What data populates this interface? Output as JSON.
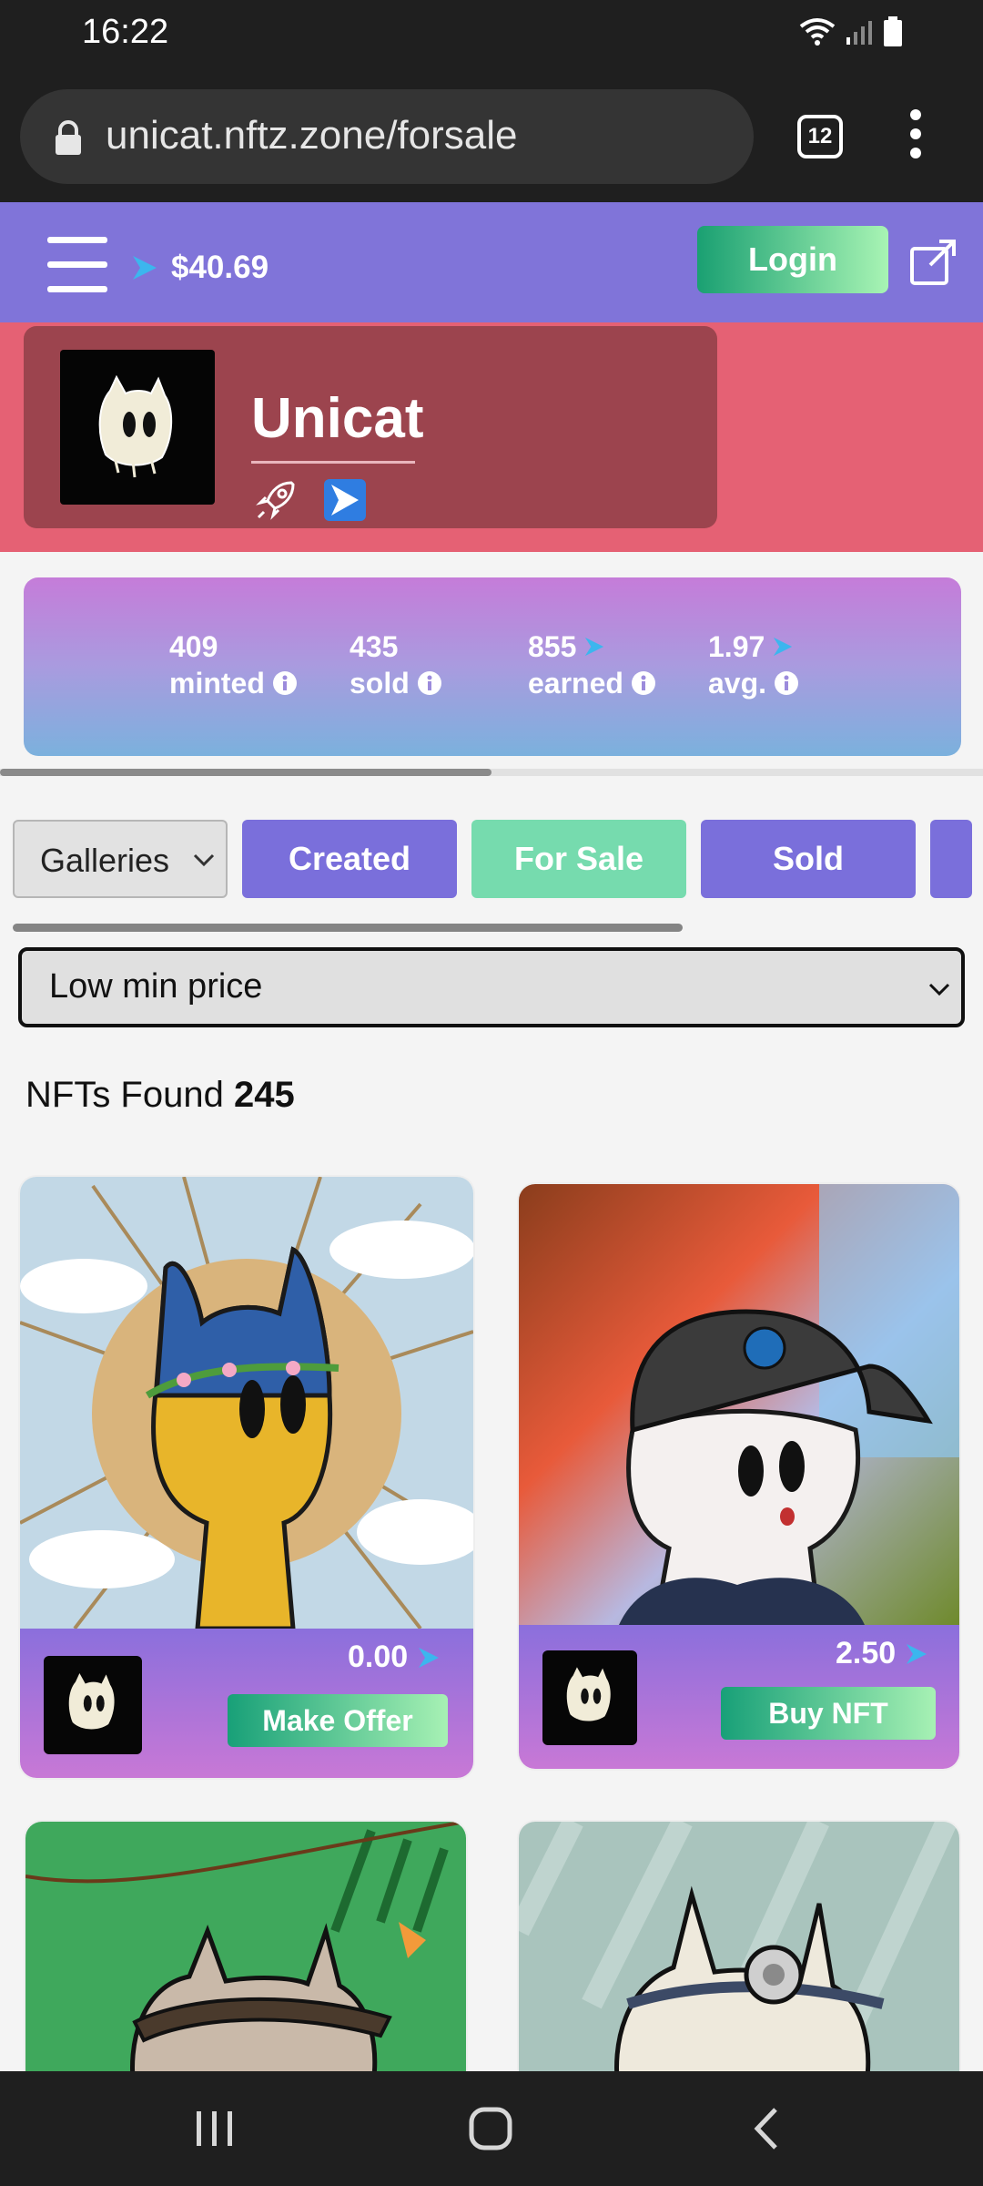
{
  "status_bar": {
    "time": "16:22"
  },
  "browser": {
    "url": "unicat.nftz.zone/forsale",
    "tab_count": "12"
  },
  "header": {
    "balance": "$40.69",
    "login_label": "Login"
  },
  "profile": {
    "name": "Unicat"
  },
  "stats": [
    {
      "value": "409",
      "label": "minted",
      "has_currency": false
    },
    {
      "value": "435",
      "label": "sold",
      "has_currency": false
    },
    {
      "value": "855",
      "label": "earned",
      "has_currency": true
    },
    {
      "value": "1.97",
      "label": "avg.",
      "has_currency": true
    }
  ],
  "filters": {
    "galleries_label": "Galleries",
    "tabs": [
      "Created",
      "For Sale",
      "Sold"
    ],
    "active_tab": "For Sale",
    "sort_value": "Low min price"
  },
  "results": {
    "label": "NFTs Found",
    "count": "245"
  },
  "nfts": [
    {
      "price": "0.00",
      "action_label": "Make Offer"
    },
    {
      "price": "2.50",
      "action_label": "Buy NFT"
    }
  ],
  "colors": {
    "header": "#8074d9",
    "profile_band": "#e56174",
    "profile_card": "#9c444e",
    "tab_default": "#7a6fdb",
    "tab_active": "#76dbae",
    "button_gradient_start": "#18a078",
    "button_gradient_end": "#a7f1b4"
  }
}
